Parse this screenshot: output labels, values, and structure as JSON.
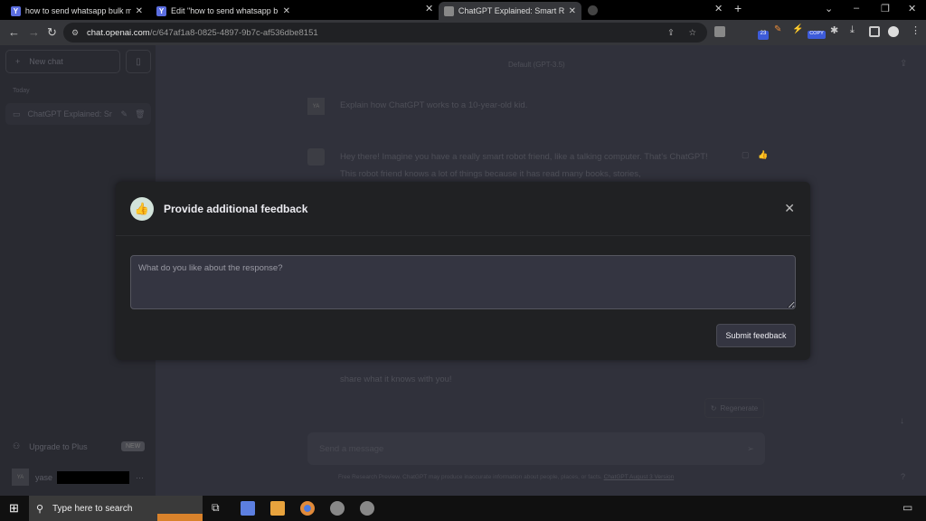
{
  "browser": {
    "tabs": [
      {
        "title": "how to send whatsapp bulk mes",
        "favicon": "Y"
      },
      {
        "title": "Edit \"how to send whatsapp bulk",
        "favicon": "Y"
      },
      {
        "title": "ChatGPT Explained: Smart Robot",
        "favicon": "chatgpt-icon",
        "active": true
      }
    ],
    "new_tab": "+",
    "url_domain": "chat.openai.com",
    "url_path": "/c/647af1a8-0825-4897-9b7c-af536dbe8151",
    "extensions": [
      {
        "badge": "23"
      },
      {
        "badge": "COPY"
      }
    ]
  },
  "sidebar": {
    "new_chat": "New chat",
    "section": "Today",
    "chats": [
      {
        "title": "ChatGPT Explained: Sr"
      }
    ],
    "upgrade": "Upgrade to Plus",
    "new_badge": "NEW",
    "user_initials": "YA",
    "user_name": "yase"
  },
  "main": {
    "model": "Default (GPT-3.5)",
    "user_initials": "YA",
    "user_message": "Explain how ChatGPT works to a 10-year-old kid.",
    "assistant_message_visible_start": "Hey there! Imagine you have a really smart robot friend, like a talking computer. That's ChatGPT! This robot friend knows a lot of things because it has read many books, stories,",
    "assistant_message_visible_end": "share what it knows with you!",
    "regenerate": "Regenerate",
    "input_placeholder": "Send a message",
    "footer_text": "Free Research Preview. ChatGPT may produce inaccurate information about people, places, or facts. ",
    "footer_link": "ChatGPT August 3 Version",
    "help": "?"
  },
  "modal": {
    "title": "Provide additional feedback",
    "placeholder": "What do you like about the response?",
    "value": "",
    "submit": "Submit feedback",
    "icon": "thumbs-up-icon"
  },
  "taskbar": {
    "search_placeholder": "Type here to search"
  },
  "colors": {
    "modal_bg": "#202123",
    "input_bg": "#343541",
    "thumb_bg": "#d2e3da"
  }
}
